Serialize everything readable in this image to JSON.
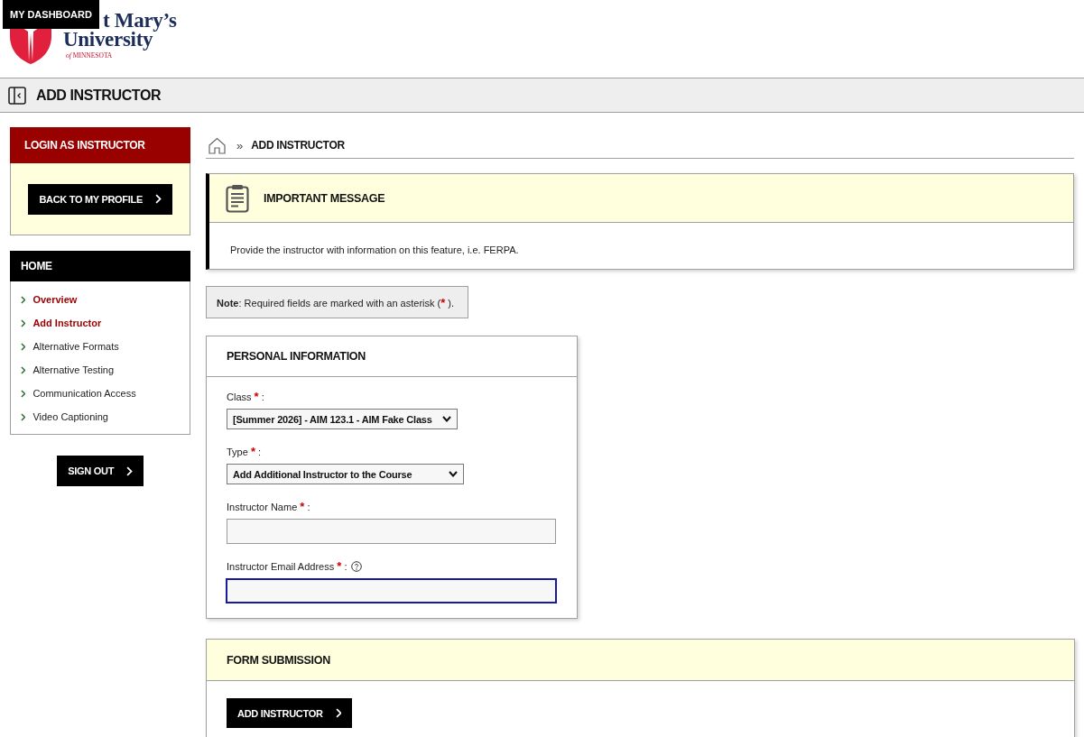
{
  "skip_link": {
    "label": "MY DASHBOARD"
  },
  "logo": {
    "line_1": "t Mary’s",
    "line_2": "University",
    "line_3": "*of* MINNESOTA"
  },
  "title_bar": {
    "title": "ADD INSTRUCTOR"
  },
  "sidebar": {
    "login_panel": {
      "title": "LOGIN AS INSTRUCTOR",
      "button": "BACK TO MY PROFILE"
    },
    "nav_panel": {
      "title": "HOME",
      "items": [
        {
          "label": "Overview",
          "selected": true
        },
        {
          "label": "Add Instructor",
          "selected": true
        },
        {
          "label": "Alternative Formats",
          "selected": false
        },
        {
          "label": "Alternative Testing",
          "selected": false
        },
        {
          "label": "Communication Access",
          "selected": false
        },
        {
          "label": "Video Captioning",
          "selected": false
        }
      ]
    },
    "sign_out": "SIGN OUT"
  },
  "breadcrumb": {
    "separator": "»",
    "current": "ADD INSTRUCTOR"
  },
  "message": {
    "title": "IMPORTANT MESSAGE",
    "body": "Provide the instructor with information on this feature, i.e. FERPA."
  },
  "note": {
    "text": "**Note**: Required fields are marked with an asterisk (",
    "marker": "*",
    "tail": " )."
  },
  "personal_information": {
    "title": "PERSONAL INFORMATION",
    "fields": [
      {
        "kind": "select",
        "label": "Class",
        "marker": "*",
        "suffix": ":",
        "help": false,
        "focused": false,
        "value": "[Summer 2026] - AIM 123.1 - AIM Fake Class"
      },
      {
        "kind": "select",
        "label": "Type",
        "marker": "*",
        "suffix": ":",
        "help": false,
        "focused": false,
        "value": "Add Additional Instructor to the Course"
      },
      {
        "kind": "text",
        "label": "Instructor Name",
        "marker": "*",
        "suffix": ":",
        "help": false,
        "focused": false
      },
      {
        "kind": "text",
        "label": "Instructor Email Address",
        "marker": "*",
        "suffix": ":",
        "help": true,
        "focused": true
      }
    ]
  },
  "form_submission": {
    "title": "FORM SUBMISSION",
    "button": "ADD INSTRUCTOR"
  }
}
